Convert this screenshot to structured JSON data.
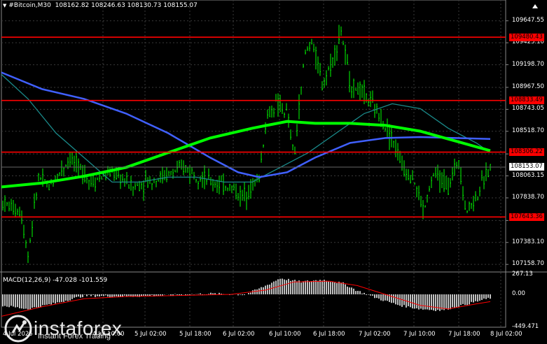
{
  "chart_info": {
    "symbol": "#Bitcoin,M30",
    "ohlc": "108162.82 108246.63 108130.73 108155.07"
  },
  "macd": {
    "label": "MACD(12,26,9) -47.028 -101.559",
    "axis": [
      "267.13",
      "0.00",
      "-449.471"
    ]
  },
  "price_axis": [
    "109647.55",
    "109423.10",
    "109198.70",
    "108967.50",
    "108743.05",
    "108518.70",
    "108287.50",
    "108063.15",
    "107838.70",
    "107607.50",
    "107383.10",
    "107158.70"
  ],
  "levels": [
    {
      "label": "109480.43",
      "color": "#ff0000"
    },
    {
      "label": "108833.49",
      "color": "#ff0000"
    },
    {
      "label": "108306.22",
      "color": "#ff0000"
    },
    {
      "label": "107643.36",
      "color": "#ff0000"
    }
  ],
  "current_price": "108153.07",
  "time_axis": [
    "4 Jul 2025",
    "4 Jul 10:00",
    "5 Jul 02:00",
    "5 Jul 18:00",
    "6 Jul 02:00",
    "6 Jul 10:00",
    "6 Jul 18:00",
    "7 Jul 02:00",
    "7 Jul 10:00",
    "7 Jul 18:00",
    "8 Jul 02:00"
  ],
  "brand": {
    "name": "instaforex",
    "tagline": "Instant Forex Trading"
  },
  "colors": {
    "candles": "#00ff00",
    "ma_fast": "#00ff00",
    "ma_blue": "#4060ff",
    "ma_teal": "#1a8a8a",
    "levels": "#ff0000",
    "grid": "#3a3a3a",
    "macd_hist": "#c0c0c0",
    "macd_signal": "#ff0000"
  }
}
